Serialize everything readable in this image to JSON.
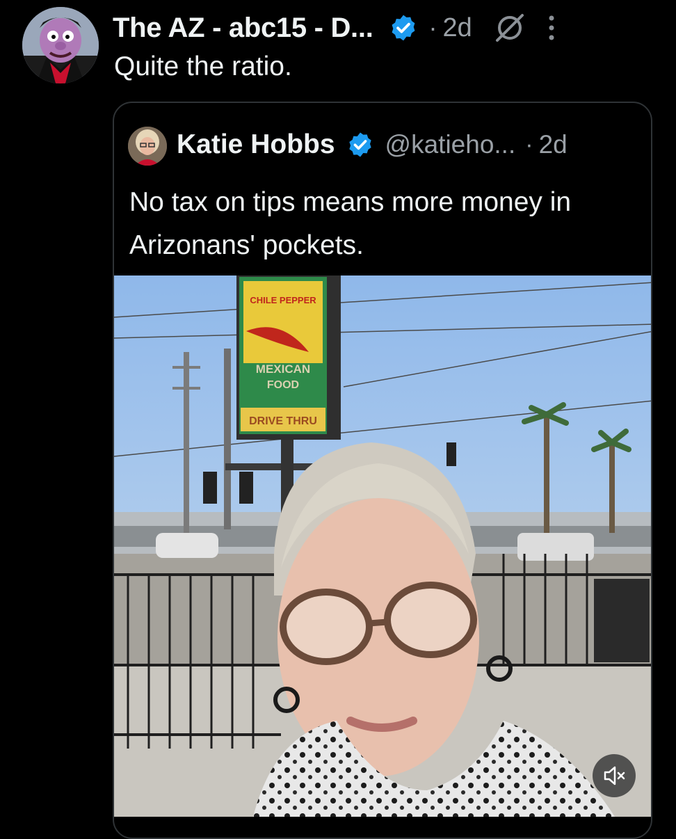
{
  "post": {
    "display_name": "The AZ - abc15 - D...",
    "time": "2d",
    "separator": "·",
    "text": "Quite the ratio."
  },
  "quote": {
    "display_name": "Katie Hobbs",
    "handle": "@katieho...",
    "time": "2d",
    "separator": "·",
    "text": "No tax on tips means more money in Arizonans' pockets."
  },
  "video": {
    "sign_brand": "CHILE PEPPER",
    "sign_line1": "MEXICAN",
    "sign_line2": "FOOD",
    "sign_line3": "DRIVE THRU",
    "muted": true
  },
  "colors": {
    "background": "#000000",
    "text_primary": "#eff3f4",
    "text_secondary": "#9aa0a6",
    "verified": "#1d9bf0",
    "border": "#2f3336"
  },
  "icons": [
    "verified-badge-icon",
    "grok-icon",
    "more-options-icon",
    "muted-speaker-icon"
  ]
}
